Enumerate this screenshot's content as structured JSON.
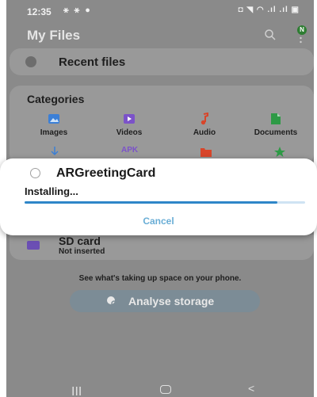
{
  "status_bar": {
    "time": "12:35",
    "left_icons": "⚹ ⚹ ●",
    "right_icons": "◘ ◥ ◠ .ıl .ıl ▣"
  },
  "header": {
    "title": "My Files",
    "avatar_letter": "N"
  },
  "recent": {
    "label": "Recent files"
  },
  "categories": {
    "title": "Categories",
    "items": [
      {
        "label": "Images",
        "icon": "image-icon",
        "color": "#3b7fd6"
      },
      {
        "label": "Videos",
        "icon": "video-icon",
        "color": "#7b52c9"
      },
      {
        "label": "Audio",
        "icon": "music-note-icon",
        "color": "#d8452a"
      },
      {
        "label": "Documents",
        "icon": "document-icon",
        "color": "#2e9a46"
      }
    ],
    "row2": [
      {
        "icon": "download-icon",
        "color": "#3b7fd6"
      },
      {
        "icon": "apk-icon",
        "text": "APK",
        "color": "#7b52c9"
      },
      {
        "icon": "compressed-icon",
        "color": "#d8452a"
      },
      {
        "icon": "favourites-star-icon",
        "color": "#2e9a46"
      }
    ]
  },
  "dialog": {
    "title": "ARGreetingCard",
    "status": "Installing...",
    "progress": 0.9,
    "cancel_label": "Cancel",
    "progress_color": "#2e86c8"
  },
  "storage": {
    "sd_title": "SD card",
    "sd_subtitle": "Not inserted",
    "hint": "See what's taking up space on your phone.",
    "button_label": "Analyse storage"
  },
  "navbar": {
    "recents": "III",
    "back": "<"
  }
}
